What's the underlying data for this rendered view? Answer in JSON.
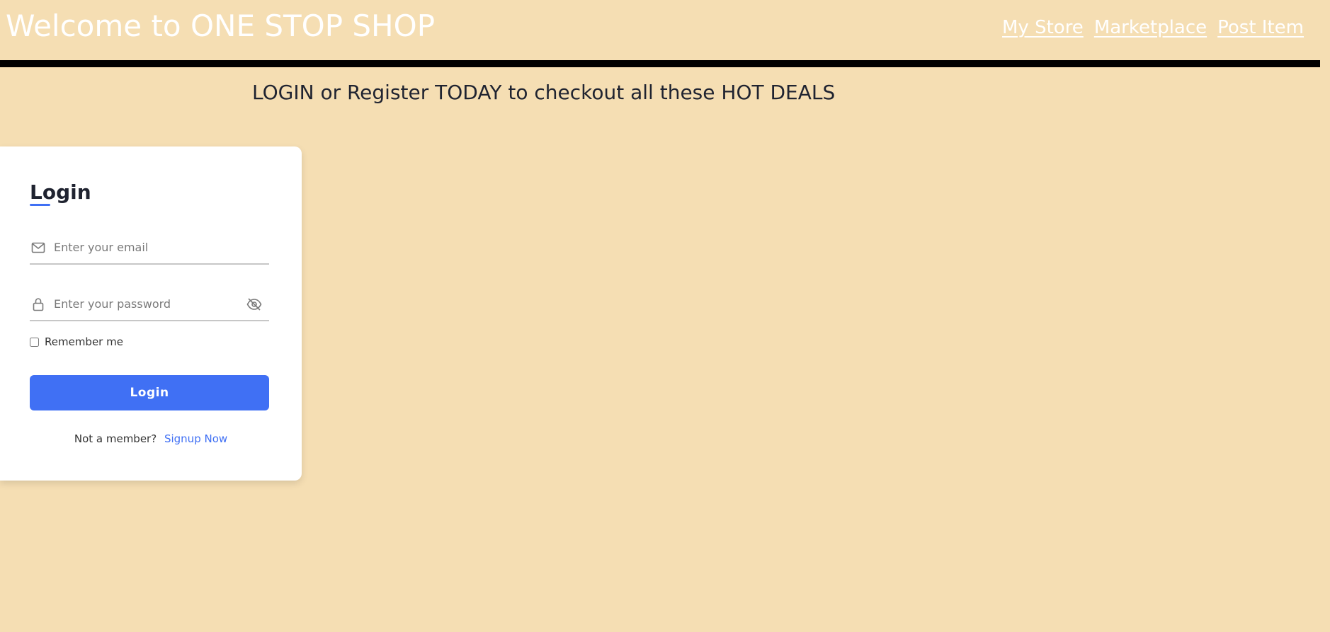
{
  "header": {
    "title": "Welcome to ONE STOP SHOP",
    "nav": [
      {
        "label": "My Store"
      },
      {
        "label": "Marketplace"
      },
      {
        "label": "Post Item"
      }
    ]
  },
  "promo": {
    "text": "LOGIN or Register TODAY to checkout all these HOT DEALS"
  },
  "login_form": {
    "title": "Login",
    "email": {
      "placeholder": "Enter your email",
      "value": ""
    },
    "password": {
      "placeholder": "Enter your password",
      "value": ""
    },
    "remember_label": "Remember me",
    "remember_checked": false,
    "submit_label": "Login",
    "signup_prompt": "Not a member?",
    "signup_link": "Signup Now"
  },
  "colors": {
    "background": "#f5deb3",
    "accent": "#4070f4",
    "header_rule": "#000000",
    "card": "#ffffff"
  },
  "icons": {
    "email": "envelope-icon",
    "password": "lock-icon",
    "toggle_password": "eye-slash-icon"
  }
}
